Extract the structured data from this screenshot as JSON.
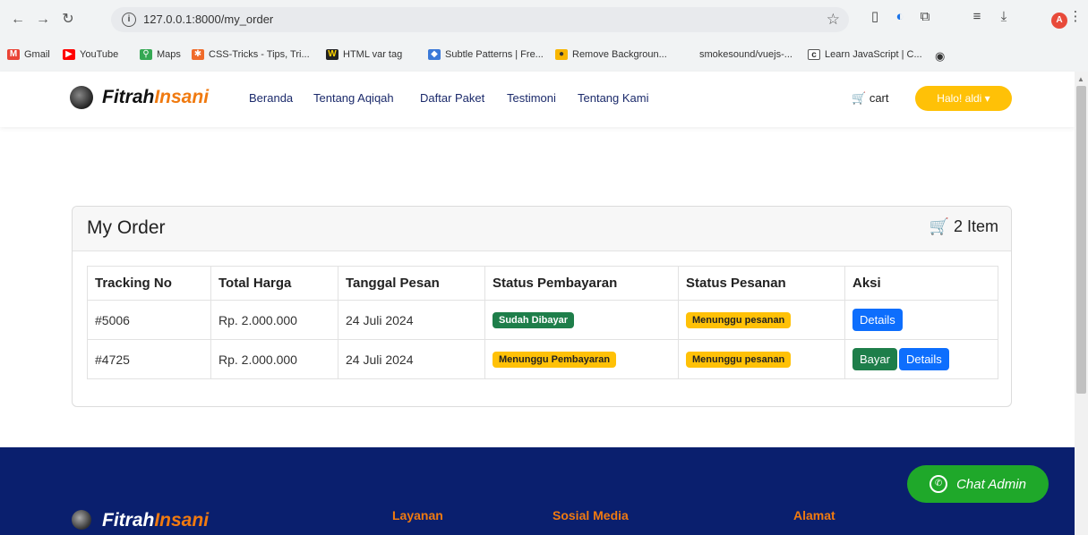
{
  "browser": {
    "url": "127.0.0.1:8000/my_order",
    "avatar_letter": "A",
    "bookmarks": [
      {
        "label": "Gmail",
        "icon": "M"
      },
      {
        "label": "YouTube",
        "icon": "▶"
      },
      {
        "label": "Maps",
        "icon": "⚲"
      },
      {
        "label": "CSS-Tricks - Tips, Tri...",
        "icon": "✱"
      },
      {
        "label": "HTML var tag",
        "icon": "W"
      },
      {
        "label": "Subtle Patterns | Fre...",
        "icon": "◆"
      },
      {
        "label": "Remove Backgroun...",
        "icon": "●"
      },
      {
        "label": "smokesound/vuejs-...",
        "icon": ""
      },
      {
        "label": "Learn JavaScript | C...",
        "icon": "c"
      }
    ]
  },
  "site": {
    "logo_part1": "Fitrah",
    "logo_part2": "Insani",
    "nav": [
      "Beranda",
      "Tentang Aqiqah",
      "Daftar Paket",
      "Testimoni",
      "Tentang Kami"
    ],
    "cart_label": "cart",
    "user_label": "Halo! aldi ▾"
  },
  "order": {
    "title": "My Order",
    "item_count": "2 Item",
    "columns": [
      "Tracking No",
      "Total Harga",
      "Tanggal Pesan",
      "Status Pembayaran",
      "Status Pesanan",
      "Aksi"
    ],
    "rows": [
      {
        "tracking": "#5006",
        "total": "Rp. 2.000.000",
        "date": "24 Juli 2024",
        "payment": "Sudah Dibayar",
        "status": "Menunggu pesanan",
        "details": "Details"
      },
      {
        "tracking": "#4725",
        "total": "Rp. 2.000.000",
        "date": "24 Juli 2024",
        "payment": "Menunggu Pembayaran",
        "status": "Menunggu pesanan",
        "pay": "Bayar",
        "details": "Details"
      }
    ]
  },
  "footer": {
    "logo_part1": "Fitrah",
    "logo_part2": "Insani",
    "cols": [
      "Layanan",
      "Sosial Media",
      "Alamat"
    ],
    "chat": "Chat Admin"
  },
  "colors": {
    "accent": "#f07a10",
    "footer_bg": "#0a1f6e",
    "badge_green": "#1e7e4a",
    "badge_yellow": "#ffc107",
    "btn_blue": "#0d6efd",
    "chat_green": "#1fa82a"
  }
}
